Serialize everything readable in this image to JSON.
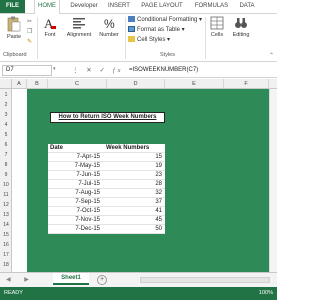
{
  "ribbon_tabs": [
    "FILE",
    "HOME",
    "Developer",
    "INSERT",
    "PAGE LAYOUT",
    "FORMULAS",
    "DATA"
  ],
  "clipboard": {
    "paste_label": "Paste",
    "group_label": "Clipboard"
  },
  "groups": {
    "font": "Font",
    "alignment": "Alignment",
    "number": "Number",
    "cells": "Cells",
    "editing": "Editing"
  },
  "styles": {
    "conditional": "Conditional Formatting",
    "format_table": "Format as Table",
    "cell_styles": "Cell Styles",
    "group_label": "Styles"
  },
  "formula_bar": {
    "name_box": "D7",
    "formula": "=ISOWEEKNUMBER(C7)"
  },
  "columns": [
    "A",
    "B",
    "C",
    "D",
    "E",
    "F"
  ],
  "rows": [
    "1",
    "2",
    "3",
    "4",
    "5",
    "6",
    "7",
    "8",
    "9",
    "10",
    "11",
    "12",
    "13",
    "14",
    "15",
    "16",
    "17",
    "18"
  ],
  "sheet_title": "How to Return ISO Week Numbers",
  "table": {
    "headers": [
      "Date",
      "Week Numbers"
    ],
    "rows": [
      [
        "7-Apr-15",
        "15"
      ],
      [
        "7-May-15",
        "19"
      ],
      [
        "7-Jun-15",
        "23"
      ],
      [
        "7-Jul-15",
        "28"
      ],
      [
        "7-Aug-15",
        "32"
      ],
      [
        "7-Sep-15",
        "37"
      ],
      [
        "7-Oct-15",
        "41"
      ],
      [
        "7-Nov-15",
        "45"
      ],
      [
        "7-Dec-15",
        "50"
      ]
    ]
  },
  "sheet_tab": "Sheet1",
  "status": {
    "ready": "READY",
    "zoom": "100%"
  },
  "colors": {
    "accent": "#217346",
    "sheet_bg": "#2e8b57"
  }
}
